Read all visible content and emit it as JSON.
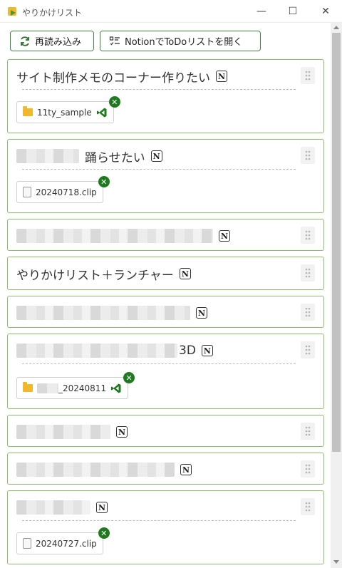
{
  "window": {
    "title": "やりかけリスト",
    "minimize_glyph": "—",
    "maximize_glyph": "☐",
    "close_glyph": "✕"
  },
  "toolbar": {
    "reload_label": "再読み込み",
    "notion_label": "NotionでToDoリストを開く"
  },
  "colors": {
    "accent": "#3d8a3d",
    "card_border": "#8cc06a",
    "remove_badge": "#1f7a1f",
    "folder": "#f1b82d",
    "vscode": "#1f7a1f"
  },
  "icons": {
    "notion": "N",
    "remove": "✕"
  },
  "items": [
    {
      "title": "サイト制作メモのコーナー作りたい",
      "attachments": [
        {
          "type": "folder",
          "name": "11ty_sample",
          "opener": "vscode"
        }
      ]
    },
    {
      "title": "踊らせたい",
      "attachments": [
        {
          "type": "clip",
          "name": "20240718.clip"
        }
      ]
    },
    {
      "title": "",
      "attachments": []
    },
    {
      "title": "やりかけリスト＋ランチャー",
      "attachments": []
    },
    {
      "title": "",
      "attachments": []
    },
    {
      "title": "3D",
      "attachments": [
        {
          "type": "folder",
          "name": "_20240811",
          "opener": "vscode"
        }
      ]
    },
    {
      "title": "",
      "attachments": []
    },
    {
      "title": "",
      "attachments": []
    },
    {
      "title": "",
      "attachments": [
        {
          "type": "clip",
          "name": "20240727.clip"
        }
      ]
    }
  ]
}
